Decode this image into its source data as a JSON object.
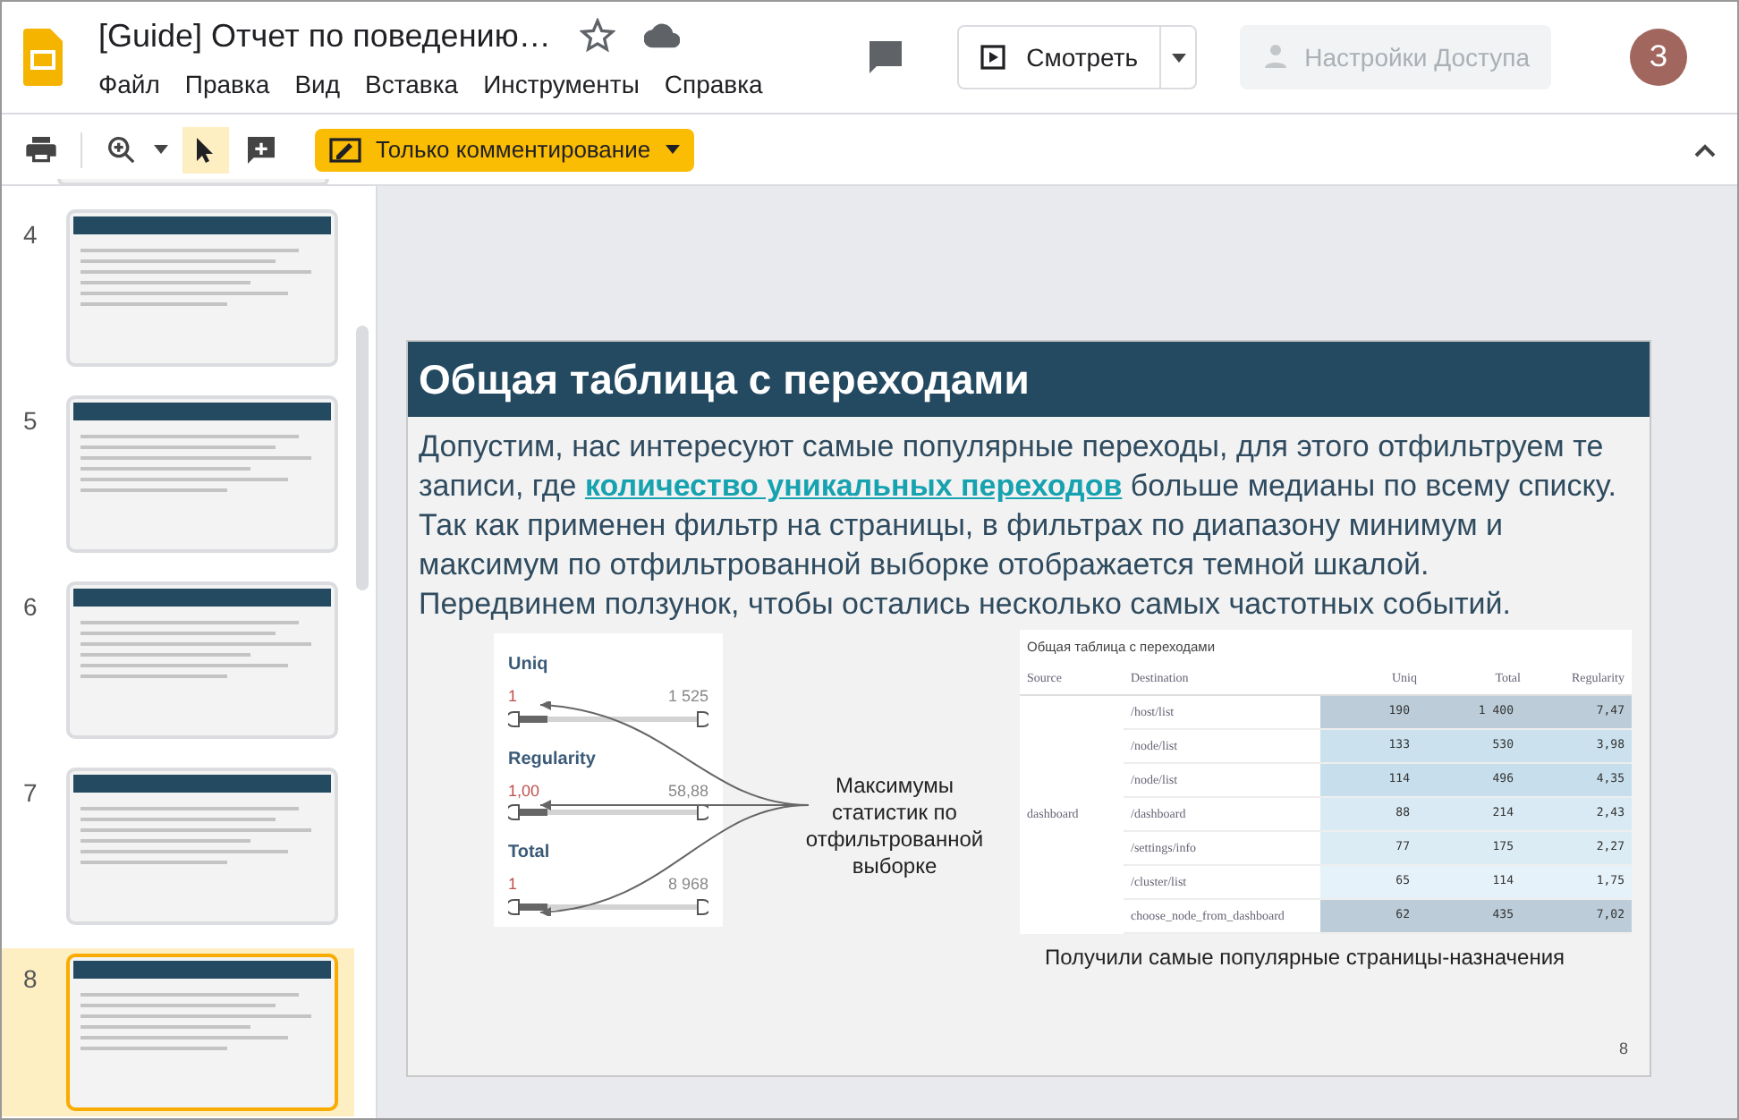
{
  "header": {
    "title": "[Guide] Отчет по поведению…",
    "starred": false,
    "menu": [
      "Файл",
      "Правка",
      "Вид",
      "Вставка",
      "Инструменты",
      "Справка"
    ],
    "present_button": "Смотреть",
    "share_button": "Настройки Доступа",
    "avatar": "З"
  },
  "toolbar": {
    "mode_button": "Только комментирование"
  },
  "thumbnails": [
    {
      "number": "4",
      "selected": false
    },
    {
      "number": "5",
      "selected": false
    },
    {
      "number": "6",
      "selected": false
    },
    {
      "number": "7",
      "selected": false
    },
    {
      "number": "8",
      "selected": true
    }
  ],
  "slide": {
    "title": "Общая таблица с переходами",
    "paragraph_1": "Допустим, нас интересуют самые популярные переходы, для этого отфильтруем те записи, где",
    "link": "количество уникальных переходов",
    "paragraph_1_end": "больше медианы по всему списку.",
    "paragraph_2": "Так как применен фильтр на страницы, в фильтрах по диапазону минимум и максимум по отфильтрованной выборке отображается темной шкалой.",
    "paragraph_3": "Передвинем ползунок, чтобы остались несколько самых частотных событий.",
    "filters": [
      {
        "label": "Uniq",
        "min": "1",
        "max": "1 525"
      },
      {
        "label": "Regularity",
        "min": "1,00",
        "max": "58,88"
      },
      {
        "label": "Total",
        "min": "1",
        "max": "8 968"
      }
    ],
    "callout": "Максимумы статистик по отфильтрованной выборке",
    "table": {
      "title": "Общая таблица с переходами",
      "columns": [
        "Source",
        "Destination",
        "Uniq",
        "Total",
        "Regularity"
      ],
      "source": "dashboard",
      "rows": [
        {
          "destination": "/host/list",
          "uniq": "190",
          "total": "1 400",
          "regularity": "7,47",
          "color": "#bccdd9"
        },
        {
          "destination": "/node/list",
          "uniq": "133",
          "total": "530",
          "regularity": "3,98",
          "color": "#cbe2ee"
        },
        {
          "destination": "/node/list",
          "uniq": "114",
          "total": "496",
          "regularity": "4,35",
          "color": "#c7dfec"
        },
        {
          "destination": "/dashboard",
          "uniq": "88",
          "total": "214",
          "regularity": "2,43",
          "color": "#d9eaf4"
        },
        {
          "destination": "/settings/info",
          "uniq": "77",
          "total": "175",
          "regularity": "2,27",
          "color": "#dcecf5"
        },
        {
          "destination": "/cluster/list",
          "uniq": "65",
          "total": "114",
          "regularity": "1,75",
          "color": "#e6f2f9"
        },
        {
          "destination": "choose_node_from_dashboard",
          "uniq": "62",
          "total": "435",
          "regularity": "7,02",
          "color": "#bccdd9"
        }
      ]
    },
    "caption": "Получили самые популярные страницы-назначения",
    "page_number": "8"
  }
}
